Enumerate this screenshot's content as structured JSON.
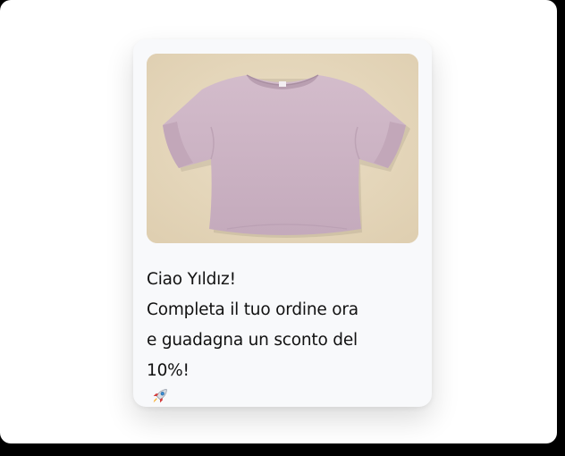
{
  "card": {
    "image": {
      "subject": "lavender t-shirt",
      "icon": "tshirt-image",
      "background_color": "#e6d7bb",
      "garment_color": "#cfb7c8"
    },
    "message": {
      "line1": "Ciao Yıldız!",
      "line2": "Completa il tuo ordine ora",
      "line3": "e guadagna un sconto del",
      "line4": "10%!",
      "emoji_icon": "rocket-icon"
    }
  }
}
